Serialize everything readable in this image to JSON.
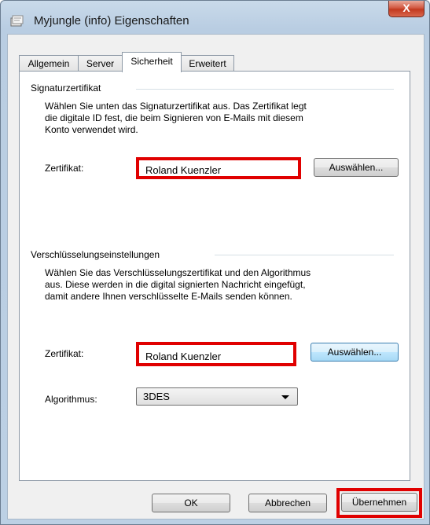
{
  "window": {
    "title": "Myjungle (info) Eigenschaften",
    "close_glyph": "X"
  },
  "tabs": [
    {
      "label": "Allgemein"
    },
    {
      "label": "Server"
    },
    {
      "label": "Sicherheit"
    },
    {
      "label": "Erweitert"
    }
  ],
  "signature": {
    "group_title": "Signaturzertifikat",
    "desc_lines": [
      "Wählen Sie unten das Signaturzertifikat aus. Das Zertifikat legt",
      "die digitale ID fest, die beim Signieren von E-Mails mit diesem",
      "Konto verwendet wird."
    ],
    "cert_label": "Zertifikat:",
    "cert_value": "Roland Kuenzler",
    "choose_label": "Auswählen..."
  },
  "encryption": {
    "group_title": "Verschlüsselungseinstellungen",
    "desc_lines": [
      "Wählen Sie das Verschlüsselungszertifikat und den Algorithmus",
      "aus. Diese werden in die digital signierten Nachricht eingefügt,",
      "damit andere Ihnen verschlüsselte E-Mails senden können."
    ],
    "cert_label": "Zertifikat:",
    "cert_value": "Roland Kuenzler",
    "choose_label": "Auswählen...",
    "algorithm_label": "Algorithmus:",
    "algorithm_value": "3DES"
  },
  "footer": {
    "ok_label": "OK",
    "cancel_label": "Abbrechen",
    "apply_label": "Übernehmen"
  }
}
